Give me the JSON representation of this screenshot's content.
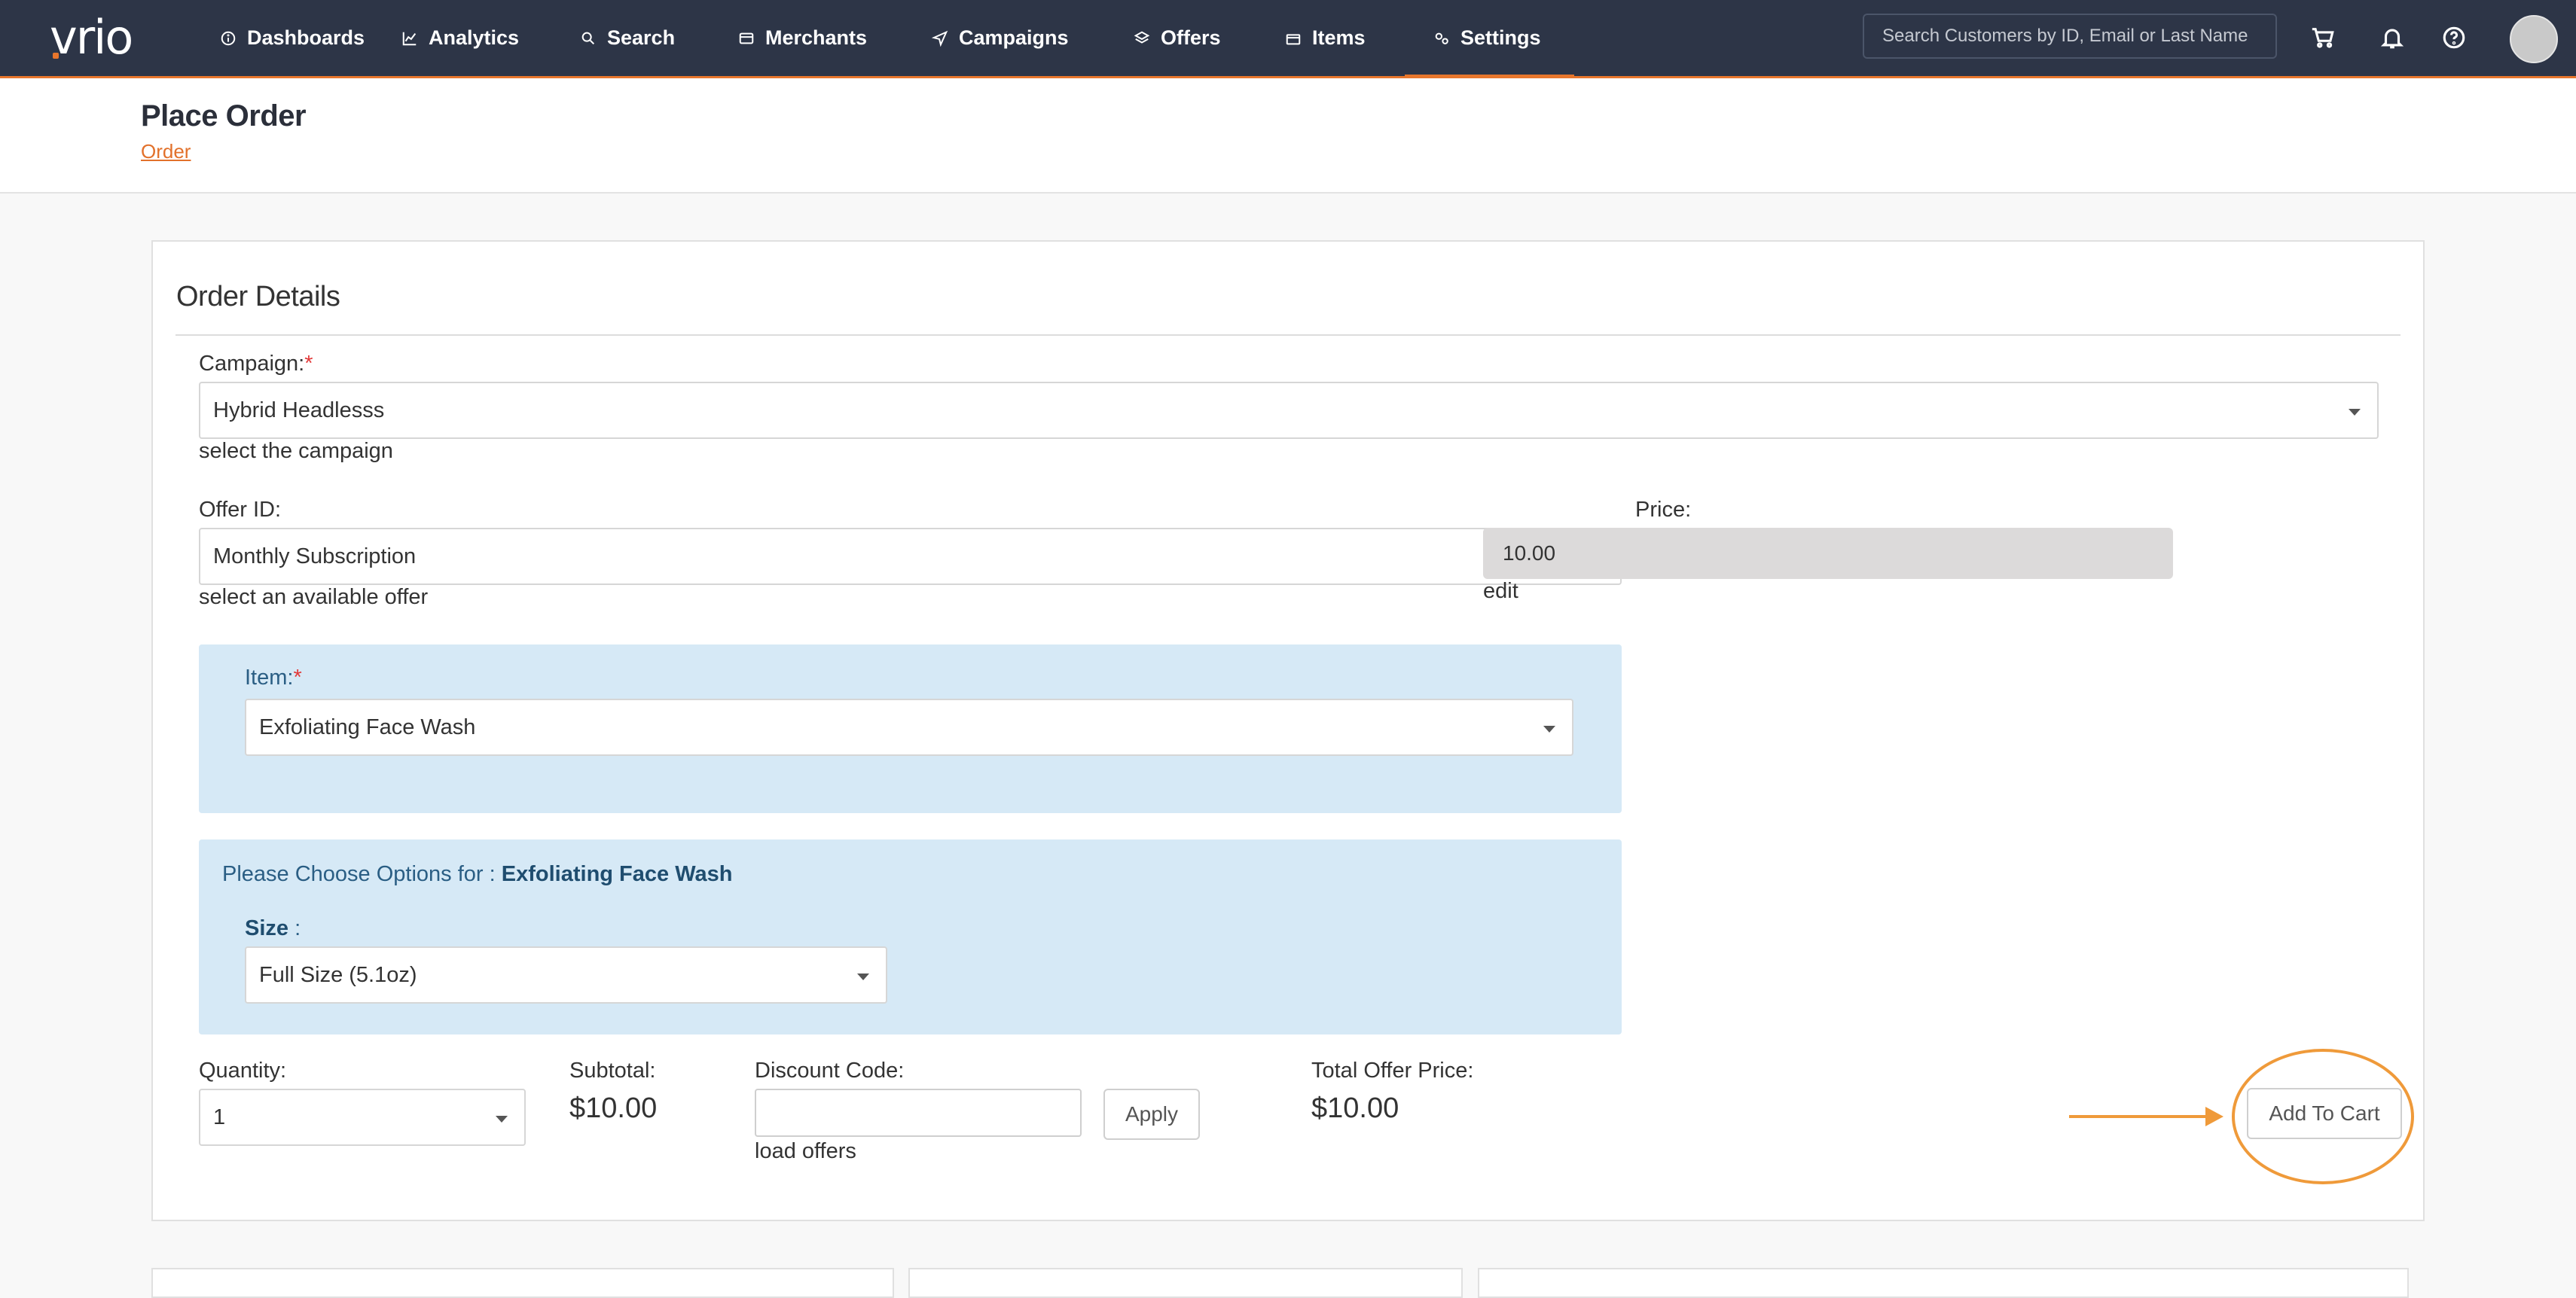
{
  "nav": {
    "logo": "vrio",
    "items": [
      {
        "label": "Dashboards",
        "icon": "info-circle-icon"
      },
      {
        "label": "Analytics",
        "icon": "line-chart-icon"
      },
      {
        "label": "Search",
        "icon": "search-icon"
      },
      {
        "label": "Merchants",
        "icon": "credit-card-icon"
      },
      {
        "label": "Campaigns",
        "icon": "paper-plane-icon"
      },
      {
        "label": "Offers",
        "icon": "layers-icon"
      },
      {
        "label": "Items",
        "icon": "box-icon"
      },
      {
        "label": "Settings",
        "icon": "gears-icon"
      }
    ],
    "active": "Settings",
    "search_placeholder": "Search Customers by ID, Email or Last Name"
  },
  "header": {
    "title": "Place Order",
    "breadcrumb": "Order"
  },
  "order": {
    "section_title": "Order Details",
    "campaign": {
      "label": "Campaign:",
      "required_mark": "*",
      "value": "Hybrid Headlesss",
      "help": "select the campaign"
    },
    "offer": {
      "label": "Offer ID:",
      "value": "Monthly Subscription",
      "help": "select an available offer"
    },
    "price": {
      "label": "Price:",
      "value": "10.00",
      "help": "edit"
    },
    "item": {
      "label": "Item:",
      "required_mark": "*",
      "value": "Exfoliating Face Wash"
    },
    "options": {
      "prefix": "Please Choose Options for : ",
      "item_name": "Exfoliating Face Wash",
      "size_label": "Size",
      "size_sep": " :",
      "size_value": "Full Size (5.1oz)"
    },
    "quantity": {
      "label": "Quantity:",
      "value": "1"
    },
    "subtotal": {
      "label": "Subtotal:",
      "value": "$10.00"
    },
    "discount": {
      "label": "Discount Code:",
      "value": "",
      "apply_label": "Apply",
      "help": "load offers"
    },
    "total": {
      "label": "Total Offer Price:",
      "value": "$10.00"
    },
    "add_to_cart_label": "Add To Cart"
  },
  "colors": {
    "nav_bg": "#2d3547",
    "accent": "#e8762c",
    "panel_bg": "#d6e9f6",
    "annotation": "#ef9a3a"
  }
}
